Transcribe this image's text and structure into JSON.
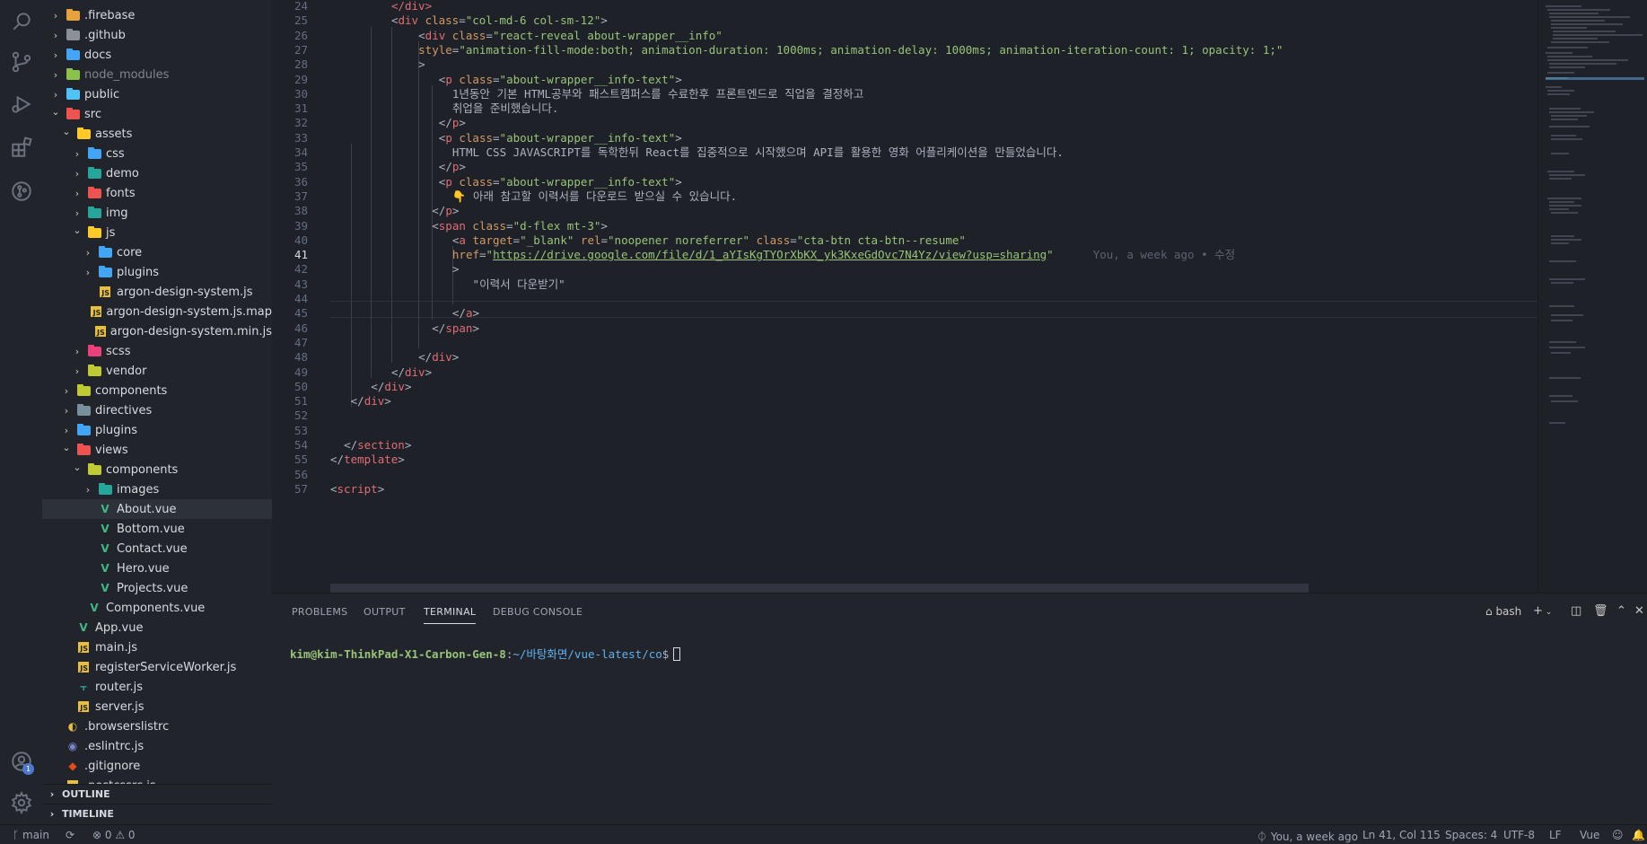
{
  "activity": [
    "files-icon",
    "search-icon",
    "source-control-icon",
    "run-debug-icon",
    "extensions-icon",
    "git-graph-icon"
  ],
  "account_badge": "1",
  "sidebar": {
    "items": [
      {
        "label": ".firebase",
        "type": "folder",
        "depth": 1,
        "color": "#e8a23b"
      },
      {
        "label": ".github",
        "type": "folder",
        "depth": 1,
        "color": "#8a9199"
      },
      {
        "label": "docs",
        "type": "folder",
        "depth": 1,
        "color": "#42a5f5"
      },
      {
        "label": "node_modules",
        "type": "folder",
        "depth": 1,
        "color": "#8bc34a",
        "dim": true
      },
      {
        "label": "public",
        "type": "folder",
        "depth": 1,
        "color": "#4fc3f7"
      },
      {
        "label": "src",
        "type": "folder-open",
        "depth": 1,
        "color": "#ef5350"
      },
      {
        "label": "assets",
        "type": "folder-open",
        "depth": 2,
        "color": "#ffca28"
      },
      {
        "label": "css",
        "type": "folder",
        "depth": 3,
        "color": "#42a5f5"
      },
      {
        "label": "demo",
        "type": "folder",
        "depth": 3,
        "color": "#26a69a"
      },
      {
        "label": "fonts",
        "type": "folder",
        "depth": 3,
        "color": "#ef5350"
      },
      {
        "label": "img",
        "type": "folder",
        "depth": 3,
        "color": "#26a69a"
      },
      {
        "label": "js",
        "type": "folder-open",
        "depth": 3,
        "color": "#ffca28"
      },
      {
        "label": "core",
        "type": "folder",
        "depth": 4,
        "color": "#42a5f5"
      },
      {
        "label": "plugins",
        "type": "folder",
        "depth": 4,
        "color": "#42a5f5"
      },
      {
        "label": "argon-design-system.js",
        "type": "js",
        "depth": 4
      },
      {
        "label": "argon-design-system.js.map",
        "type": "js",
        "depth": 4
      },
      {
        "label": "argon-design-system.min.js",
        "type": "js",
        "depth": 4
      },
      {
        "label": "scss",
        "type": "folder",
        "depth": 3,
        "color": "#ec407a"
      },
      {
        "label": "vendor",
        "type": "folder",
        "depth": 3,
        "color": "#c0ca33"
      },
      {
        "label": "components",
        "type": "folder",
        "depth": 2,
        "color": "#c0ca33"
      },
      {
        "label": "directives",
        "type": "folder",
        "depth": 2,
        "color": "#78909c"
      },
      {
        "label": "plugins",
        "type": "folder",
        "depth": 2,
        "color": "#42a5f5"
      },
      {
        "label": "views",
        "type": "folder-open",
        "depth": 2,
        "color": "#ef5350"
      },
      {
        "label": "components",
        "type": "folder-open",
        "depth": 3,
        "color": "#c0ca33"
      },
      {
        "label": "images",
        "type": "folder",
        "depth": 4,
        "color": "#26a69a"
      },
      {
        "label": "About.vue",
        "type": "vue",
        "depth": 4,
        "selected": true
      },
      {
        "label": "Bottom.vue",
        "type": "vue",
        "depth": 4
      },
      {
        "label": "Contact.vue",
        "type": "vue",
        "depth": 4
      },
      {
        "label": "Hero.vue",
        "type": "vue",
        "depth": 4
      },
      {
        "label": "Projects.vue",
        "type": "vue",
        "depth": 4
      },
      {
        "label": "Components.vue",
        "type": "vue",
        "depth": 3
      },
      {
        "label": "App.vue",
        "type": "vue",
        "depth": 2
      },
      {
        "label": "main.js",
        "type": "js",
        "depth": 2
      },
      {
        "label": "registerServiceWorker.js",
        "type": "js",
        "depth": 2
      },
      {
        "label": "router.js",
        "type": "router",
        "depth": 2
      },
      {
        "label": "server.js",
        "type": "js",
        "depth": 2
      },
      {
        "label": ".browserslistrc",
        "type": "browsers",
        "depth": 1
      },
      {
        "label": ".eslintrc.js",
        "type": "eslint",
        "depth": 1
      },
      {
        "label": ".gitignore",
        "type": "git",
        "depth": 1
      },
      {
        "label": ".postcssrc.js",
        "type": "js",
        "depth": 1
      }
    ],
    "outline": "OUTLINE",
    "timeline": "TIMELINE"
  },
  "editor": {
    "current_line": 41,
    "blame": "You, a week ago • 수정",
    "lines": [
      {
        "n": 24,
        "indent": 9,
        "tokens": [
          [
            "tag",
            "</div>"
          ]
        ]
      },
      {
        "n": 25,
        "indent": 9,
        "tokens": [
          [
            "pun",
            "<"
          ],
          [
            "tag",
            "div"
          ],
          [
            "attr",
            " class"
          ],
          [
            "pun",
            "="
          ],
          [
            "str",
            "\"col-md-6 col-sm-12\""
          ],
          [
            "pun",
            ">"
          ]
        ]
      },
      {
        "n": 26,
        "indent": 13,
        "tokens": [
          [
            "pun",
            "<"
          ],
          [
            "tag",
            "div"
          ],
          [
            "attr",
            " class"
          ],
          [
            "pun",
            "="
          ],
          [
            "str",
            "\"react-reveal about-wrapper__info\""
          ]
        ]
      },
      {
        "n": 27,
        "indent": 13,
        "tokens": [
          [
            "attr",
            "style"
          ],
          [
            "pun",
            "="
          ],
          [
            "str",
            "\"animation-fill-mode:both; animation-duration: 1000ms; animation-delay: 1000ms; animation-iteration-count: 1; opacity: 1;\""
          ]
        ]
      },
      {
        "n": 28,
        "indent": 13,
        "tokens": [
          [
            "pun",
            ">"
          ]
        ]
      },
      {
        "n": 29,
        "indent": 16,
        "tokens": [
          [
            "pun",
            "<"
          ],
          [
            "tag",
            "p"
          ],
          [
            "attr",
            " class"
          ],
          [
            "pun",
            "="
          ],
          [
            "str",
            "\"about-wrapper__info-text\""
          ],
          [
            "pun",
            ">"
          ]
        ]
      },
      {
        "n": 30,
        "indent": 18,
        "tokens": [
          [
            "txt",
            "1년동안 기본 HTML공부와 패스트캠퍼스를 수료한후 프론트엔드로 직업을 결정하고"
          ]
        ]
      },
      {
        "n": 31,
        "indent": 18,
        "tokens": [
          [
            "txt",
            "취업을 준비했습니다."
          ]
        ]
      },
      {
        "n": 32,
        "indent": 16,
        "tokens": [
          [
            "pun",
            "</"
          ],
          [
            "tag",
            "p"
          ],
          [
            "pun",
            ">"
          ]
        ]
      },
      {
        "n": 33,
        "indent": 16,
        "tokens": [
          [
            "pun",
            "<"
          ],
          [
            "tag",
            "p"
          ],
          [
            "attr",
            " class"
          ],
          [
            "pun",
            "="
          ],
          [
            "str",
            "\"about-wrapper__info-text\""
          ],
          [
            "pun",
            ">"
          ]
        ]
      },
      {
        "n": 34,
        "indent": 18,
        "tokens": [
          [
            "txt",
            "HTML CSS JAVASCRIPT를 독학한뒤 React를 집중적으로 시작했으며 API를 활용한 영화 어플리케이션을 만들었습니다."
          ]
        ]
      },
      {
        "n": 35,
        "indent": 16,
        "tokens": [
          [
            "pun",
            "</"
          ],
          [
            "tag",
            "p"
          ],
          [
            "pun",
            ">"
          ]
        ]
      },
      {
        "n": 36,
        "indent": 16,
        "tokens": [
          [
            "pun",
            "<"
          ],
          [
            "tag",
            "p"
          ],
          [
            "attr",
            " class"
          ],
          [
            "pun",
            "="
          ],
          [
            "str",
            "\"about-wrapper__info-text\""
          ],
          [
            "pun",
            ">"
          ]
        ]
      },
      {
        "n": 37,
        "indent": 18,
        "tokens": [
          [
            "txt",
            "👇 아래 참고할 이력서를 다운로드 받으실 수 있습니다."
          ]
        ]
      },
      {
        "n": 38,
        "indent": 15,
        "tokens": [
          [
            "pun",
            "</"
          ],
          [
            "tag",
            "p"
          ],
          [
            "pun",
            ">"
          ]
        ]
      },
      {
        "n": 39,
        "indent": 15,
        "tokens": [
          [
            "pun",
            "<"
          ],
          [
            "tag",
            "span"
          ],
          [
            "attr",
            " class"
          ],
          [
            "pun",
            "="
          ],
          [
            "str",
            "\"d-flex mt-3\""
          ],
          [
            "pun",
            ">"
          ]
        ]
      },
      {
        "n": 40,
        "indent": 18,
        "tokens": [
          [
            "pun",
            "<"
          ],
          [
            "tag",
            "a"
          ],
          [
            "attr",
            " target"
          ],
          [
            "pun",
            "="
          ],
          [
            "str",
            "\"_blank\""
          ],
          [
            "attr",
            " rel"
          ],
          [
            "pun",
            "="
          ],
          [
            "str",
            "\"noopener noreferrer\""
          ],
          [
            "attr",
            " class"
          ],
          [
            "pun",
            "="
          ],
          [
            "str",
            "\"cta-btn cta-btn--resume\""
          ]
        ]
      },
      {
        "n": 41,
        "indent": 18,
        "tokens": [
          [
            "attr",
            "href"
          ],
          [
            "pun",
            "="
          ],
          [
            "str",
            "\""
          ],
          [
            "link",
            "https://drive.google.com/file/d/1_aYIsKgTYOrXbKX_yk3KxeGdOvc7N4Yz/view?usp=sharing"
          ],
          [
            "str",
            "\""
          ]
        ]
      },
      {
        "n": 42,
        "indent": 18,
        "tokens": [
          [
            "pun",
            ">"
          ]
        ]
      },
      {
        "n": 43,
        "indent": 21,
        "tokens": [
          [
            "txt",
            "\"이력서 다운받기\""
          ]
        ]
      },
      {
        "n": 44,
        "indent": 0,
        "tokens": []
      },
      {
        "n": 45,
        "indent": 18,
        "tokens": [
          [
            "pun",
            "</"
          ],
          [
            "tag",
            "a"
          ],
          [
            "pun",
            ">"
          ]
        ]
      },
      {
        "n": 46,
        "indent": 15,
        "tokens": [
          [
            "pun",
            "</"
          ],
          [
            "tag",
            "span"
          ],
          [
            "pun",
            ">"
          ]
        ]
      },
      {
        "n": 47,
        "indent": 0,
        "tokens": []
      },
      {
        "n": 48,
        "indent": 13,
        "tokens": [
          [
            "pun",
            "</"
          ],
          [
            "tag",
            "div"
          ],
          [
            "pun",
            ">"
          ]
        ]
      },
      {
        "n": 49,
        "indent": 9,
        "tokens": [
          [
            "pun",
            "</"
          ],
          [
            "tag",
            "div"
          ],
          [
            "pun",
            ">"
          ]
        ]
      },
      {
        "n": 50,
        "indent": 6,
        "tokens": [
          [
            "pun",
            "</"
          ],
          [
            "tag",
            "div"
          ],
          [
            "pun",
            ">"
          ]
        ]
      },
      {
        "n": 51,
        "indent": 3,
        "tokens": [
          [
            "pun",
            "</"
          ],
          [
            "tag",
            "div"
          ],
          [
            "pun",
            ">"
          ]
        ]
      },
      {
        "n": 52,
        "indent": 0,
        "tokens": []
      },
      {
        "n": 53,
        "indent": 0,
        "tokens": []
      },
      {
        "n": 54,
        "indent": 2,
        "tokens": [
          [
            "pun",
            "</"
          ],
          [
            "tag",
            "section"
          ],
          [
            "pun",
            ">"
          ]
        ]
      },
      {
        "n": 55,
        "indent": 0,
        "tokens": [
          [
            "pun",
            "</"
          ],
          [
            "tag",
            "template"
          ],
          [
            "pun",
            ">"
          ]
        ]
      },
      {
        "n": 56,
        "indent": 0,
        "tokens": []
      },
      {
        "n": 57,
        "indent": 0,
        "tokens": [
          [
            "pun",
            "<"
          ],
          [
            "tag",
            "script"
          ],
          [
            "pun",
            ">"
          ]
        ]
      }
    ]
  },
  "panel": {
    "tabs": [
      "PROBLEMS",
      "OUTPUT",
      "TERMINAL",
      "DEBUG CONSOLE"
    ],
    "active_tab": "TERMINAL",
    "shell": "bash",
    "prompt_user": "kim@kim-ThinkPad-X1-Carbon-Gen-8",
    "prompt_path": "~/바탕화면/vue-latest/co",
    "prompt_symbol": "$"
  },
  "status": {
    "branch": "main",
    "errors": "0",
    "warnings": "0",
    "blame": "You, a week ago",
    "position": "Ln 41, Col 115",
    "spaces": "Spaces: 4",
    "encoding": "UTF-8",
    "eol": "LF",
    "language": "Vue"
  }
}
